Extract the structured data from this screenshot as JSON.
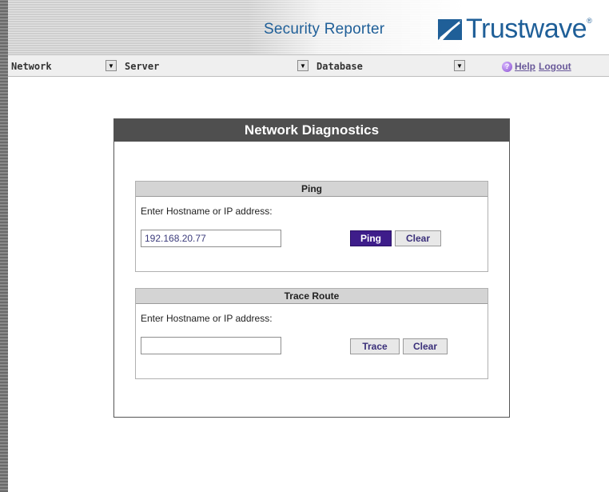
{
  "header": {
    "app_title": "Security Reporter",
    "brand_name": "Trustwave",
    "brand_reg": "®",
    "brand_logo_icon": "trustwave-logo"
  },
  "menubar": {
    "network": "Network",
    "server": "Server",
    "database": "Database",
    "help": "Help",
    "logout": "Logout",
    "help_icon": "help-icon",
    "dropdown_icon": "chevron-down-icon"
  },
  "panel": {
    "title": "Network Diagnostics"
  },
  "ping": {
    "title": "Ping",
    "label": "Enter Hostname or IP address:",
    "value": "192.168.20.77",
    "ping_button": "Ping",
    "clear_button": "Clear"
  },
  "trace": {
    "title": "Trace Route",
    "label": "Enter Hostname or IP address:",
    "value": "",
    "trace_button": "Trace",
    "clear_button": "Clear"
  },
  "colors": {
    "brand_blue": "#1f5f98",
    "panel_header": "#4f4f4f",
    "primary_button": "#3e1d8a"
  }
}
